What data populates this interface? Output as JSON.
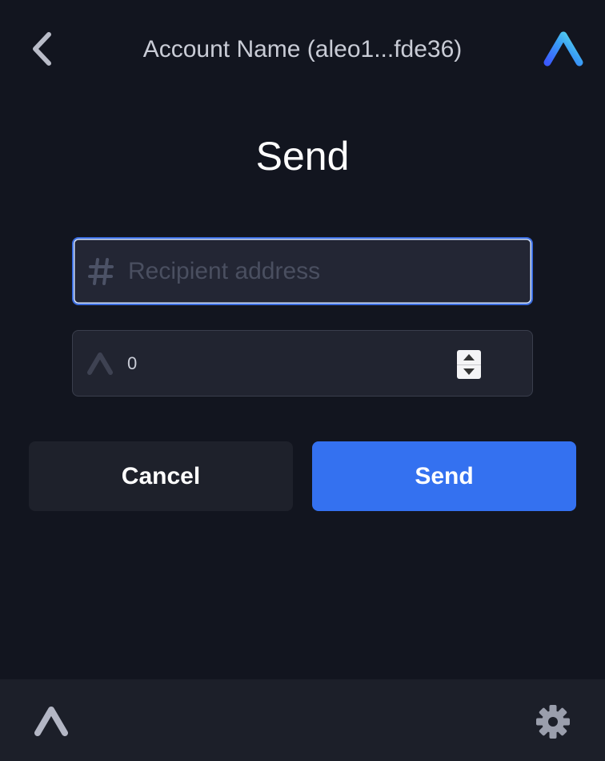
{
  "header": {
    "account_name": "Account Name (aleo1...fde36)",
    "back_icon": "chevron-left-icon",
    "logo_icon": "aleo-logo-icon"
  },
  "page": {
    "title": "Send"
  },
  "form": {
    "recipient": {
      "icon": "hash-icon",
      "placeholder": "Recipient address",
      "value": ""
    },
    "amount": {
      "icon": "aleo-mark-icon",
      "value": "0"
    }
  },
  "actions": {
    "cancel_label": "Cancel",
    "send_label": "Send"
  },
  "footer": {
    "home_icon": "aleo-home-icon",
    "settings_icon": "gear-icon"
  },
  "colors": {
    "background": "#12151f",
    "accent": "#3471f0",
    "input_background": "#232634",
    "footer_background": "#1c1f29"
  }
}
